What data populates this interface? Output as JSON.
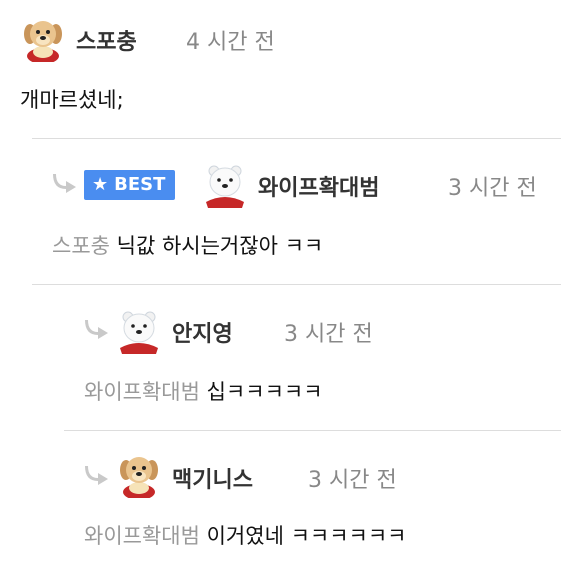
{
  "comments": [
    {
      "nickname": "스포충",
      "time": "4 시간 전",
      "avatar": "puppy-avatar",
      "text": "개마르셨네;"
    },
    {
      "badge": "BEST",
      "badge_icon": "star-icon",
      "nickname": "와이프확대범",
      "time": "3 시간 전",
      "avatar": "polar-bear-avatar",
      "mention": "스포충",
      "text": "닉값 하시는거잖아 ㅋㅋ"
    },
    {
      "nickname": "안지영",
      "time": "3 시간 전",
      "avatar": "polar-bear-avatar",
      "mention": "와이프확대범",
      "text": "십ㅋㅋㅋㅋㅋ"
    },
    {
      "nickname": "맥기니스",
      "time": "3 시간 전",
      "avatar": "puppy-avatar",
      "mention": "와이프확대범",
      "text": "이거였네 ㅋㅋㅋㅋㅋㅋ"
    }
  ],
  "colors": {
    "best_badge": "#4a8df0",
    "nickname": "#333333",
    "muted": "#888888",
    "divider": "#dddddd"
  }
}
